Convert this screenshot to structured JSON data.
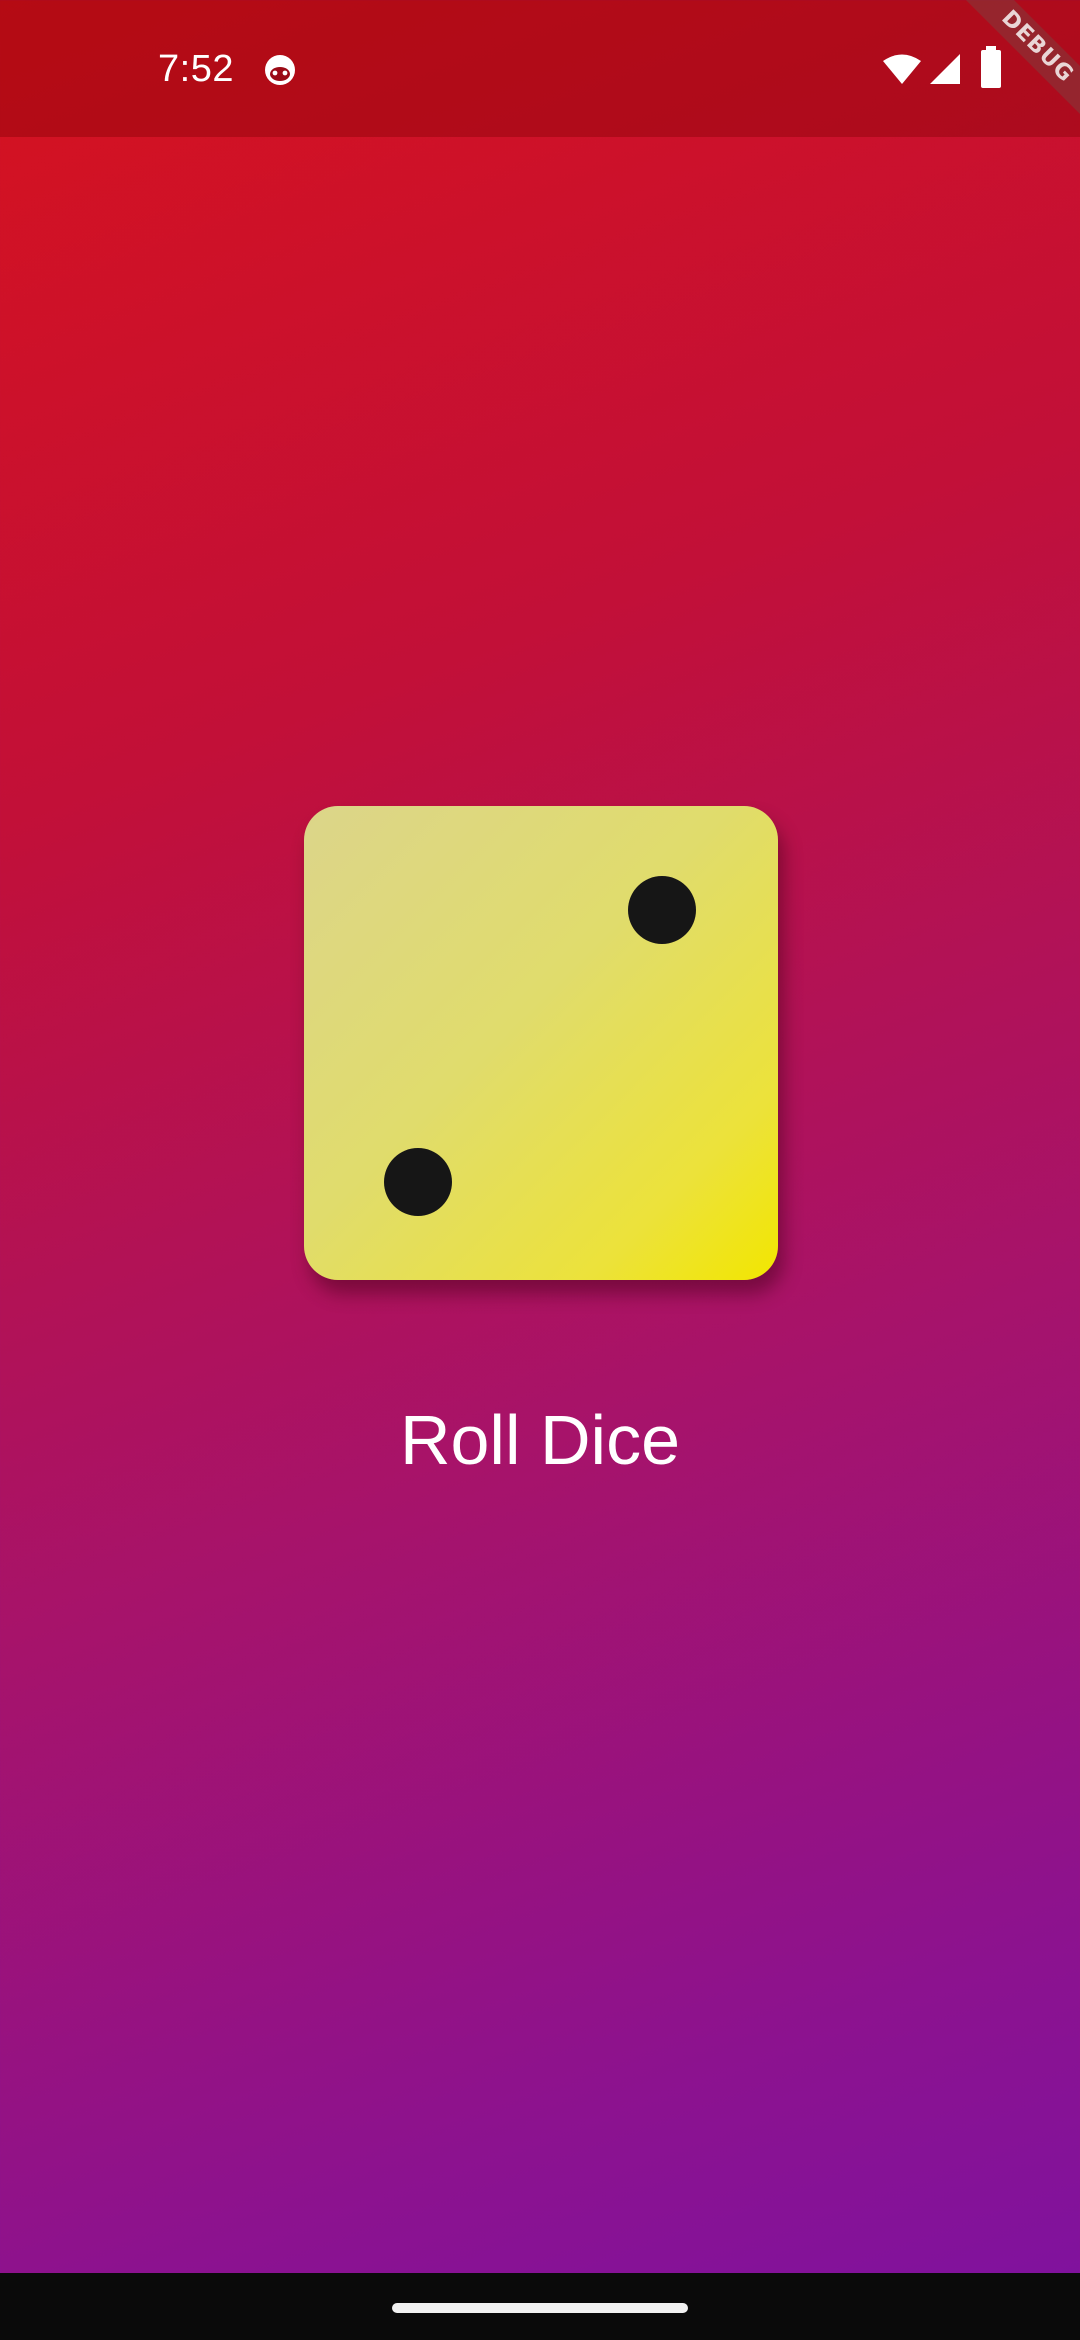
{
  "status_bar": {
    "time": "7:52",
    "notification_icon": "app-notification-icon",
    "wifi_icon": "wifi-icon",
    "signal_icon": "cell-signal-icon",
    "battery_icon": "battery-icon"
  },
  "debug_banner": {
    "label": "DEBUG"
  },
  "dice": {
    "face_value": 2,
    "face_color": "#e6df55",
    "pip_color": "#161616"
  },
  "roll_button": {
    "label": "Roll Dice"
  },
  "background": {
    "gradient_start": "#d6121e",
    "gradient_end": "#7e12a0"
  },
  "navigation": {
    "home_handle_icon": "gesture-home-handle"
  }
}
